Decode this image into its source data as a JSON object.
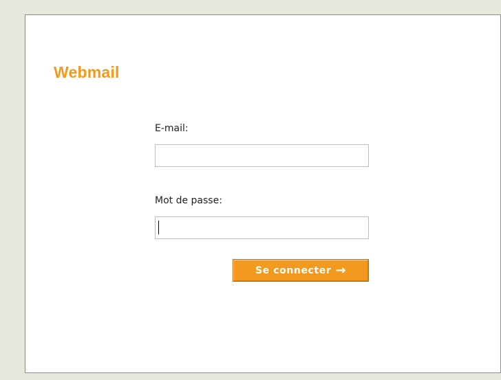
{
  "app": {
    "title": "Webmail",
    "brand_color": "#f39a1e",
    "background_color": "#e9e8dd"
  },
  "form": {
    "email_label": "E-mail:",
    "email_value": "",
    "password_label": "Mot de passe:",
    "password_value": "",
    "submit_label": "Se connecter",
    "submit_icon": "arrow-right-icon",
    "focused_field": "password"
  }
}
